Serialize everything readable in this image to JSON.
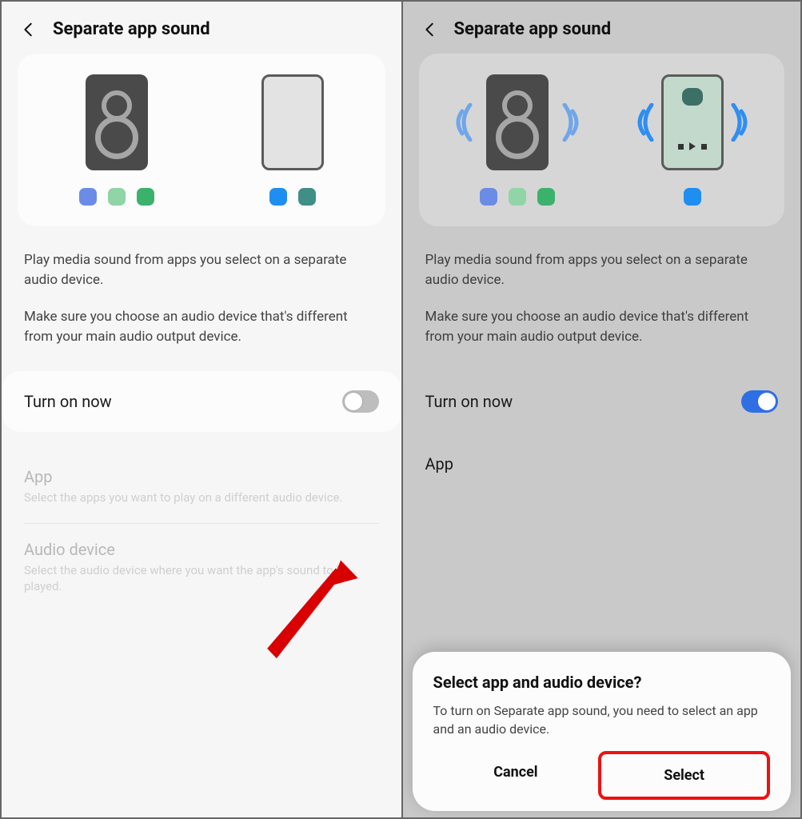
{
  "left": {
    "title": "Separate app sound",
    "desc_p1": "Play media sound from apps you select on a separate audio device.",
    "desc_p2": "Make sure you choose an audio device that's different from your main audio output device.",
    "turn_on_label": "Turn on now",
    "turn_on_state": "off",
    "app_label": "App",
    "app_sub": "Select the apps you want to play on a different audio device.",
    "device_label": "Audio device",
    "device_sub": "Select the audio device where you want the app's sound to be played."
  },
  "right": {
    "title": "Separate app sound",
    "desc_p1": "Play media sound from apps you select on a separate audio device.",
    "desc_p2": "Make sure you choose an audio device that's different from your main audio output device.",
    "turn_on_label": "Turn on now",
    "turn_on_state": "on",
    "app_label": "App",
    "sheet": {
      "title": "Select app and audio device?",
      "body": "To turn on Separate app sound, you need to select an app and an audio device.",
      "cancel": "Cancel",
      "select": "Select"
    }
  },
  "colors": {
    "accent": "#2f6fe4",
    "highlight": "#e11"
  }
}
